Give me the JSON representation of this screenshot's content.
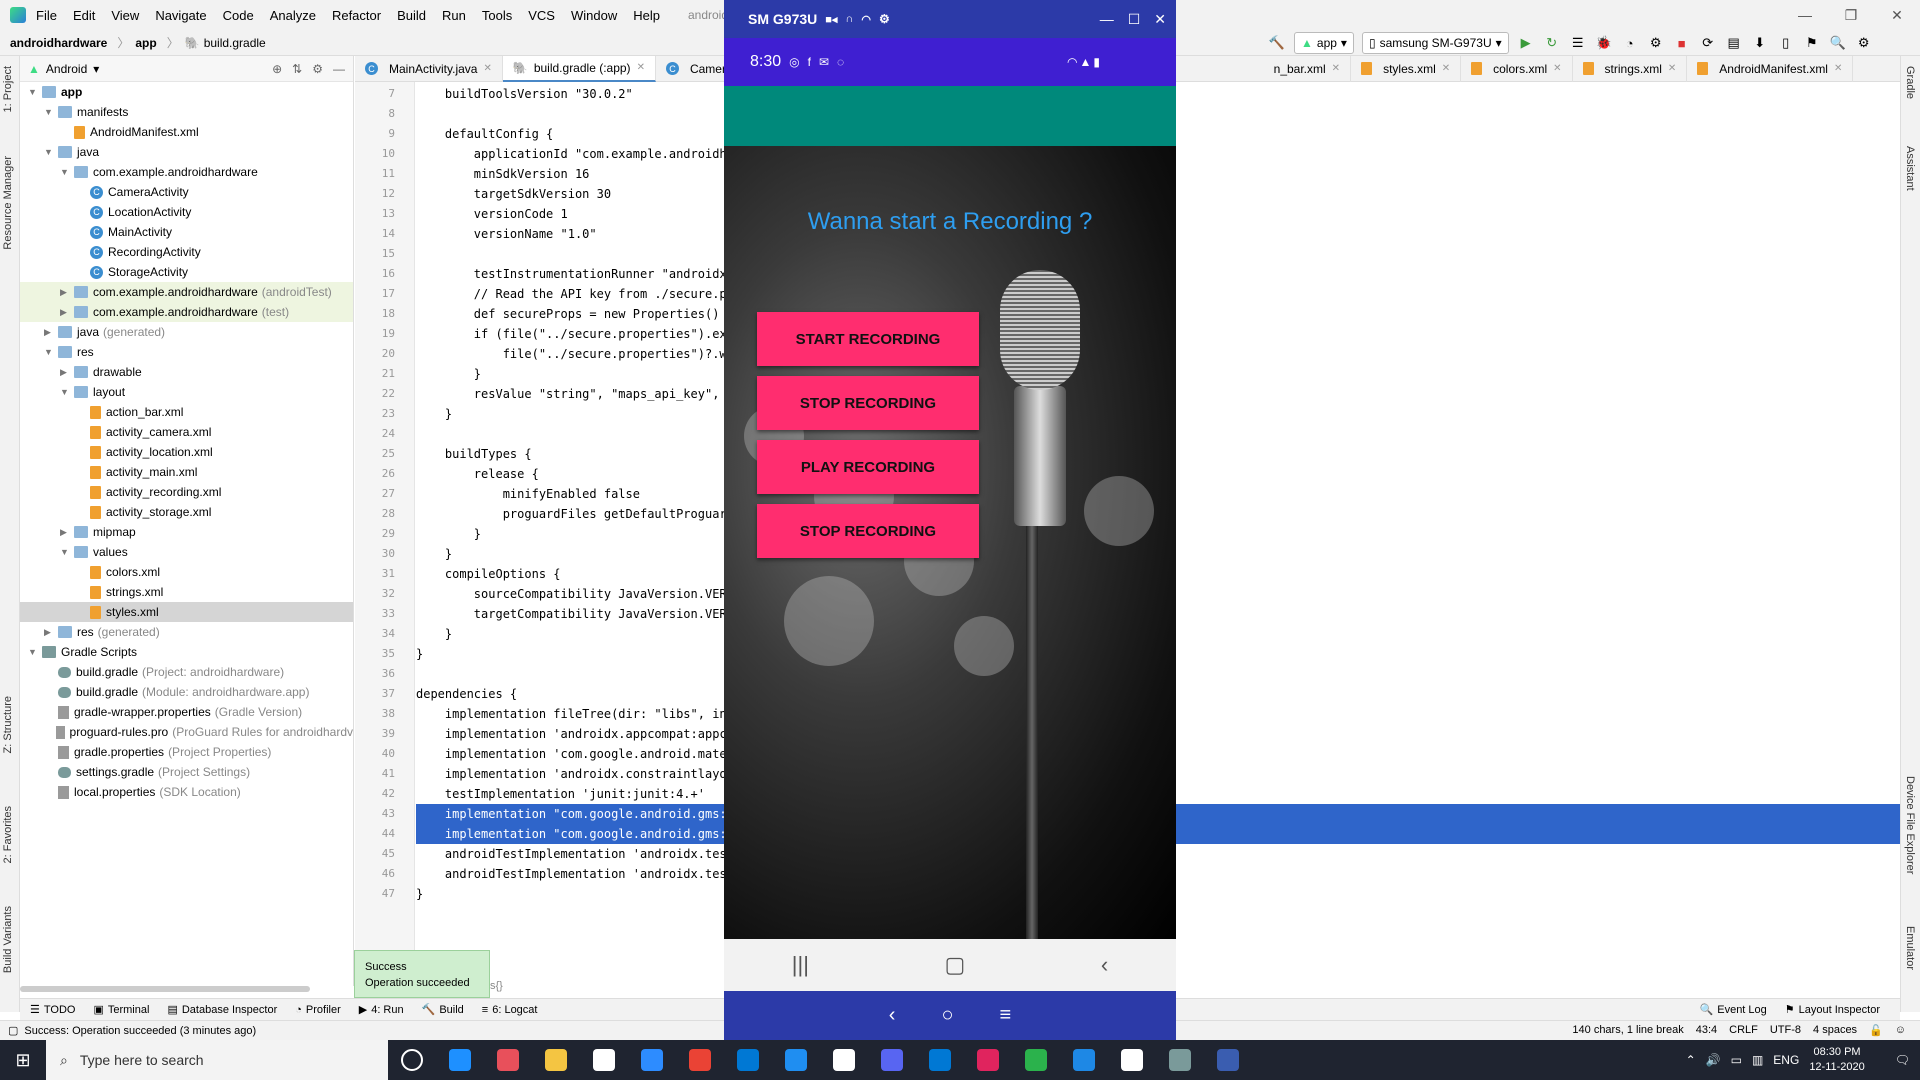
{
  "menubar": {
    "items": [
      "File",
      "Edit",
      "View",
      "Navigate",
      "Code",
      "Analyze",
      "Refactor",
      "Build",
      "Run",
      "Tools",
      "VCS",
      "Window",
      "Help"
    ],
    "window_title": "androidhardware - buil"
  },
  "navbar": {
    "crumbs": [
      "androidhardware",
      "app",
      "build.gradle"
    ],
    "run_config": "app",
    "device": "samsung SM-G973U"
  },
  "project": {
    "view": "Android",
    "tree": [
      {
        "label": "app",
        "indent": 0,
        "type": "module",
        "open": true
      },
      {
        "label": "manifests",
        "indent": 1,
        "type": "folder",
        "open": true
      },
      {
        "label": "AndroidManifest.xml",
        "indent": 2,
        "type": "xml"
      },
      {
        "label": "java",
        "indent": 1,
        "type": "folder",
        "open": true
      },
      {
        "label": "com.example.androidhardware",
        "indent": 2,
        "type": "folder",
        "open": true
      },
      {
        "label": "CameraActivity",
        "indent": 3,
        "type": "class"
      },
      {
        "label": "LocationActivity",
        "indent": 3,
        "type": "class"
      },
      {
        "label": "MainActivity",
        "indent": 3,
        "type": "class"
      },
      {
        "label": "RecordingActivity",
        "indent": 3,
        "type": "class"
      },
      {
        "label": "StorageActivity",
        "indent": 3,
        "type": "class"
      },
      {
        "label": "com.example.androidhardware",
        "extra": "(androidTest)",
        "indent": 2,
        "type": "folder",
        "closed": true,
        "hl": true
      },
      {
        "label": "com.example.androidhardware",
        "extra": "(test)",
        "indent": 2,
        "type": "folder",
        "closed": true,
        "hl": true
      },
      {
        "label": "java",
        "extra": "(generated)",
        "indent": 1,
        "type": "folder",
        "closed": true
      },
      {
        "label": "res",
        "indent": 1,
        "type": "folder",
        "open": true
      },
      {
        "label": "drawable",
        "indent": 2,
        "type": "folder",
        "closed": true
      },
      {
        "label": "layout",
        "indent": 2,
        "type": "folder",
        "open": true
      },
      {
        "label": "action_bar.xml",
        "indent": 3,
        "type": "xml"
      },
      {
        "label": "activity_camera.xml",
        "indent": 3,
        "type": "xml"
      },
      {
        "label": "activity_location.xml",
        "indent": 3,
        "type": "xml"
      },
      {
        "label": "activity_main.xml",
        "indent": 3,
        "type": "xml"
      },
      {
        "label": "activity_recording.xml",
        "indent": 3,
        "type": "xml"
      },
      {
        "label": "activity_storage.xml",
        "indent": 3,
        "type": "xml"
      },
      {
        "label": "mipmap",
        "indent": 2,
        "type": "folder",
        "closed": true
      },
      {
        "label": "values",
        "indent": 2,
        "type": "folder",
        "open": true
      },
      {
        "label": "colors.xml",
        "indent": 3,
        "type": "xml"
      },
      {
        "label": "strings.xml",
        "indent": 3,
        "type": "xml"
      },
      {
        "label": "styles.xml",
        "indent": 3,
        "type": "xml",
        "selected": true
      },
      {
        "label": "res",
        "extra": "(generated)",
        "indent": 1,
        "type": "folder",
        "closed": true
      },
      {
        "label": "Gradle Scripts",
        "indent": 0,
        "type": "gradlefolder",
        "open": true
      },
      {
        "label": "build.gradle",
        "extra": "(Project: androidhardware)",
        "indent": 1,
        "type": "gradle"
      },
      {
        "label": "build.gradle",
        "extra": "(Module: androidhardware.app)",
        "indent": 1,
        "type": "gradle"
      },
      {
        "label": "gradle-wrapper.properties",
        "extra": "(Gradle Version)",
        "indent": 1,
        "type": "prop"
      },
      {
        "label": "proguard-rules.pro",
        "extra": "(ProGuard Rules for androidhardv",
        "indent": 1,
        "type": "prop"
      },
      {
        "label": "gradle.properties",
        "extra": "(Project Properties)",
        "indent": 1,
        "type": "prop"
      },
      {
        "label": "settings.gradle",
        "extra": "(Project Settings)",
        "indent": 1,
        "type": "gradle"
      },
      {
        "label": "local.properties",
        "extra": "(SDK Location)",
        "indent": 1,
        "type": "prop"
      }
    ]
  },
  "tabs": {
    "left": [
      "MainActivity.java",
      "build.gradle (:app)",
      "CameraAc"
    ],
    "right": [
      "n_bar.xml",
      "styles.xml",
      "colors.xml",
      "strings.xml",
      "AndroidManifest.xml"
    ]
  },
  "code": {
    "lines": [
      {
        "n": "7",
        "t": "    buildToolsVersion \"30.0.2\""
      },
      {
        "n": "8",
        "t": ""
      },
      {
        "n": "9",
        "t": "    defaultConfig {"
      },
      {
        "n": "10",
        "t": "        applicationId \"com.example.androidha"
      },
      {
        "n": "11",
        "t": "        minSdkVersion 16"
      },
      {
        "n": "12",
        "t": "        targetSdkVersion 30"
      },
      {
        "n": "13",
        "t": "        versionCode 1"
      },
      {
        "n": "14",
        "t": "        versionName \"1.0\""
      },
      {
        "n": "15",
        "t": ""
      },
      {
        "n": "16",
        "t": "        testInstrumentationRunner \"androidx."
      },
      {
        "n": "17",
        "t": "        // Read the API key from ./secure.pr"
      },
      {
        "n": "18",
        "t": "        def secureProps = new Properties()"
      },
      {
        "n": "19",
        "t": "        if (file(\"../secure.properties\").exi"
      },
      {
        "n": "20",
        "t": "            file(\"../secure.properties\")?.wi"
      },
      {
        "n": "21",
        "t": "        }"
      },
      {
        "n": "22",
        "t": "        resValue \"string\", \"maps_api_key\", ("
      },
      {
        "n": "23",
        "t": "    }"
      },
      {
        "n": "24",
        "t": ""
      },
      {
        "n": "25",
        "t": "    buildTypes {"
      },
      {
        "n": "26",
        "t": "        release {"
      },
      {
        "n": "27",
        "t": "            minifyEnabled false"
      },
      {
        "n": "28",
        "t": "            proguardFiles getDefaultProguard"
      },
      {
        "n": "29",
        "t": "        }"
      },
      {
        "n": "30",
        "t": "    }"
      },
      {
        "n": "31",
        "t": "    compileOptions {"
      },
      {
        "n": "32",
        "t": "        sourceCompatibility JavaVersion.VERS"
      },
      {
        "n": "33",
        "t": "        targetCompatibility JavaVersion.VERS"
      },
      {
        "n": "34",
        "t": "    }"
      },
      {
        "n": "35",
        "t": "}"
      },
      {
        "n": "36",
        "t": ""
      },
      {
        "n": "37",
        "t": "dependencies {"
      },
      {
        "n": "38",
        "t": "    implementation fileTree(dir: \"libs\", inc"
      },
      {
        "n": "39",
        "t": "    implementation 'androidx.appcompat:appco"
      },
      {
        "n": "40",
        "t": "    implementation 'com.google.android.mater"
      },
      {
        "n": "41",
        "t": "    implementation 'androidx.constraintlayou"
      },
      {
        "n": "42",
        "t": "    testImplementation 'junit:junit:4.+'"
      },
      {
        "n": "43",
        "t": "    implementation \"com.google.android.gms:p",
        "sel": true
      },
      {
        "n": "44",
        "t": "    implementation \"com.google.android.gms:p",
        "sel": true
      },
      {
        "n": "45",
        "t": "    androidTestImplementation 'androidx.test"
      },
      {
        "n": "46",
        "t": "    androidTestImplementation 'androidx.test"
      },
      {
        "n": "47",
        "t": "}"
      }
    ]
  },
  "toast": {
    "title": "Success",
    "message": "Operation succeeded"
  },
  "tool_stubs": {
    "s_brace": "s{}"
  },
  "bottom_tools": {
    "left": [
      "TODO",
      "Terminal",
      "Database Inspector",
      "Profiler",
      "4: Run",
      "Build",
      "6: Logcat"
    ],
    "right": [
      "Event Log",
      "Layout Inspector"
    ]
  },
  "statusbar": {
    "message": "Success: Operation succeeded (3 minutes ago)",
    "chars": "140 chars, 1 line break",
    "pos": "43:4",
    "eol": "CRLF",
    "enc": "UTF-8",
    "indent": "4 spaces"
  },
  "left_strip": [
    "1: Project",
    "Resource Manager",
    "Z: Structure",
    "2: Favorites",
    "Build Variants"
  ],
  "right_strip": [
    "Gradle",
    "Assistant",
    "Device File Explorer",
    "Emulator"
  ],
  "emulator": {
    "title": "SM G973U",
    "time": "8:30",
    "heading": "Wanna start a Recording ?",
    "buttons": [
      "START RECORDING",
      "STOP RECORDING",
      "PLAY RECORDING",
      "STOP RECORDING"
    ]
  },
  "taskbar": {
    "search_placeholder": "Type here to search",
    "lang": "ENG",
    "time": "08:30 PM",
    "date": "12-11-2020",
    "app_colors": [
      "#ffffff",
      "#1e90ff",
      "#e8505b",
      "#f4c542",
      "#ffffff",
      "#2d8cff",
      "#ea4335",
      "#0078d4",
      "#1f8ef1",
      "#ffffff",
      "#5865f2",
      "#0078d4",
      "#e0245e",
      "#2bb24c",
      "#1e88e5",
      "#ffffff",
      "#7a9a9a",
      "#3a5db0"
    ]
  },
  "colors": {
    "accent_pink": "#ff2d6f",
    "app_bar_teal": "#00897b",
    "emulator_blue": "#2c3aa8",
    "heading_blue": "#2e9ef0"
  }
}
